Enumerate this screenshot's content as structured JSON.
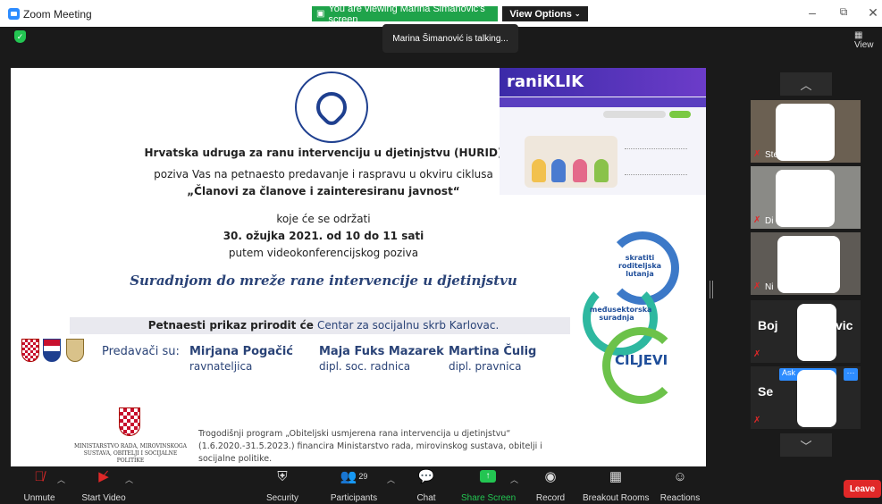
{
  "window": {
    "title": "Zoom Meeting",
    "viewing_banner": "You are viewing Marina Šimanović's screen",
    "view_options": "View Options",
    "minimize": "–",
    "restore": "⧉",
    "close": "✕"
  },
  "meeting": {
    "talking": "Marina Šimanović is talking...",
    "view_label": "View"
  },
  "slide": {
    "org_name": "Hrvatska udruga za ranu intervenciju u djetinjstvu (HURID)",
    "invite_line": "poziva Vas na petnaesto predavanje i raspravu u okviru ciklusa",
    "series_name": "„Članovi za članove i zainteresiranu javnost“",
    "held_line": "koje će se održati",
    "date_line": "30. ožujka 2021. od 10 do 11 sati",
    "via_line": "putem videokonferencijskog poziva",
    "headline": "Suradnjom do mreže rane intervencije u djetinjstvu",
    "presentation_prefix": "Petnaesti prikaz prirodit će ",
    "presentation_center": "Centar za socijalnu skrb Karlovac.",
    "lecturers_label": "Predavači su:",
    "lecturers": [
      {
        "name": "Mirjana Pogačić",
        "role": "ravnateljica"
      },
      {
        "name": "Maja Fuks Mazarek",
        "role": "dipl. soc. radnica"
      },
      {
        "name": "Martina Čulig",
        "role": "dipl. pravnica"
      }
    ],
    "raniklik_logo": "raniKLIK",
    "cycle": {
      "top": "skratiti roditeljska lutanja",
      "left": "međusektorska suradnja",
      "goal": "CILJEVI"
    },
    "ministry": "MINISTARSTVO RADA, MIROVINSKOGA SUSTAVA, OBITELJI I SOCIJALNE POLITIKE",
    "footer": "Trogodišnji program „Obiteljski usmjerena rana intervencija u djetinjstvu“ (1.6.2020.-31.5.2023.) financira Ministarstvo rada, mirovinskog sustava, obitelji i socijalne politike."
  },
  "participants_panel": {
    "tiles": [
      {
        "name": "Ste"
      },
      {
        "name": "Di"
      },
      {
        "name": "Ni"
      },
      {
        "name": "Boj",
        "name_suffix": "vic"
      },
      {
        "name": "Se",
        "ask_label": "Ask",
        "more": "···"
      }
    ]
  },
  "toolbar": {
    "unmute": "Unmute",
    "start_video": "Start Video",
    "security": "Security",
    "participants": "Participants",
    "participants_count": "29",
    "chat": "Chat",
    "share_screen": "Share Screen",
    "record": "Record",
    "breakout_rooms": "Breakout Rooms",
    "reactions": "Reactions",
    "leave": "Leave"
  },
  "colors": {
    "banner_green": "#1fa34a",
    "share_green": "#23c552",
    "leave_red": "#e02828",
    "slide_navy": "#2a4377"
  }
}
